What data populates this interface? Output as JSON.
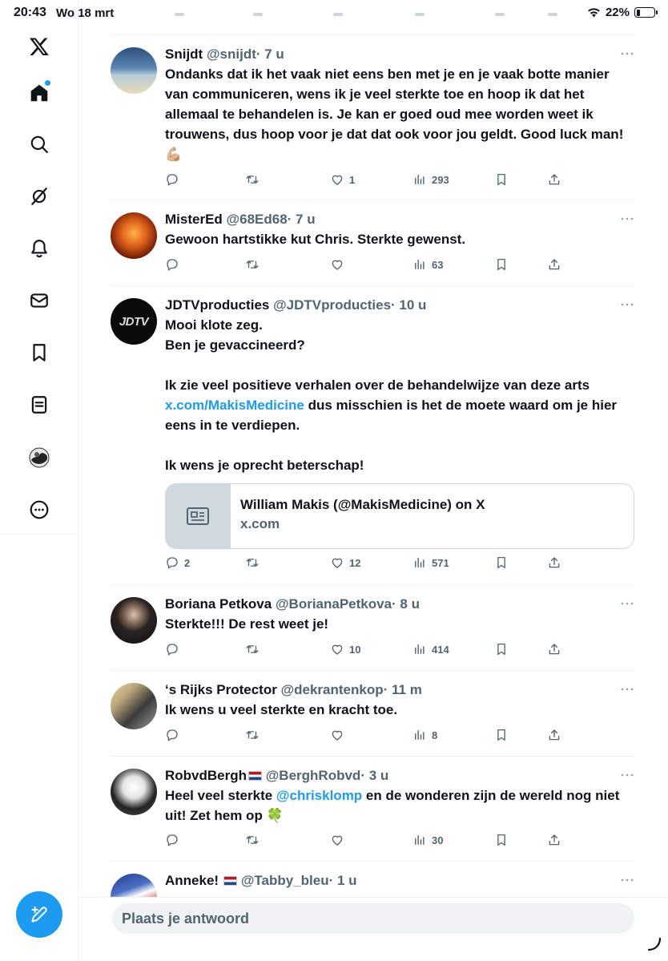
{
  "status_bar": {
    "time": "20:43",
    "date": "Wo 18 mrt",
    "battery": "22%",
    "battery_level": 0.22
  },
  "sidebar": {
    "items": [
      "x-logo-icon",
      "home-icon",
      "search-icon",
      "grok-icon",
      "notifications-icon",
      "messages-icon",
      "bookmarks-icon",
      "lists-icon",
      "profile-avatar",
      "more-icon"
    ]
  },
  "colors": {
    "accent": "#1d9bf0",
    "text": "#0f1419",
    "secondary": "#536471",
    "border": "#eff3f4"
  },
  "tweets": [
    {
      "name": "Snijdt",
      "handle": "@snijdt",
      "time": "· 7 u",
      "lines": [
        "Ondanks dat ik het vaak niet eens ben met je en je vaak botte manier van communiceren, wens ik je veel sterkte toe en hoop ik dat het allemaal te behandelen is. Je kan er goed oud mee worden weet ik trouwens, dus hoop voor je dat dat ook voor jou geldt. Good luck man! 💪🏼"
      ],
      "replies": "",
      "likes": "1",
      "views": "293"
    },
    {
      "name": "MisterEd",
      "handle": "@68Ed68",
      "time": "· 7 u",
      "lines": [
        "Gewoon hartstikke kut Chris. Sterkte gewenst."
      ],
      "replies": "",
      "likes": "",
      "views": "63"
    },
    {
      "name": "JDTVproducties",
      "handle": "@JDTVproducties",
      "time": "· 10 u",
      "line1": "Mooi klote zeg.",
      "line2": "Ben je gevaccineerd?",
      "line3": "Ik zie veel positieve verhalen over de behandelwijze van deze arts",
      "link": "x.com/MakisMedicine",
      "line3b": " dus misschien is het de moete waard om je hier eens in te verdiepen.",
      "line4": "Ik wens je oprecht beterschap!",
      "card_title": "William Makis (@MakisMedicine) on X",
      "card_domain": "x.com",
      "avatar_text": "JDTV",
      "replies": "2",
      "likes": "12",
      "views": "571"
    },
    {
      "name": "Boriana Petkova",
      "handle": "@BorianaPetkova",
      "time": "· 8 u",
      "lines": [
        "Sterkte!!! De rest weet je!"
      ],
      "replies": "",
      "likes": "10",
      "views": "414"
    },
    {
      "name": "‘s Rijks Protector",
      "handle": "@dekrantenkop",
      "time": "· 11 m",
      "lines": [
        "Ik wens u veel sterkte en kracht toe."
      ],
      "replies": "",
      "likes": "",
      "views": "8"
    },
    {
      "name": "RobvdBergh",
      "handle": "@BerghRobvd",
      "time": "· 3 u",
      "pre": "Heel veel sterkte ",
      "mention": "@chrisklomp",
      "post": " en de wonderen zijn de wereld nog niet uit! Zet hem op 🍀",
      "replies": "",
      "likes": "",
      "views": "30"
    },
    {
      "name": "Anneke!",
      "handle": "@Tabby_bleu",
      "time": "· 1 u"
    }
  ],
  "reply_placeholder": "Plaats je antwoord"
}
